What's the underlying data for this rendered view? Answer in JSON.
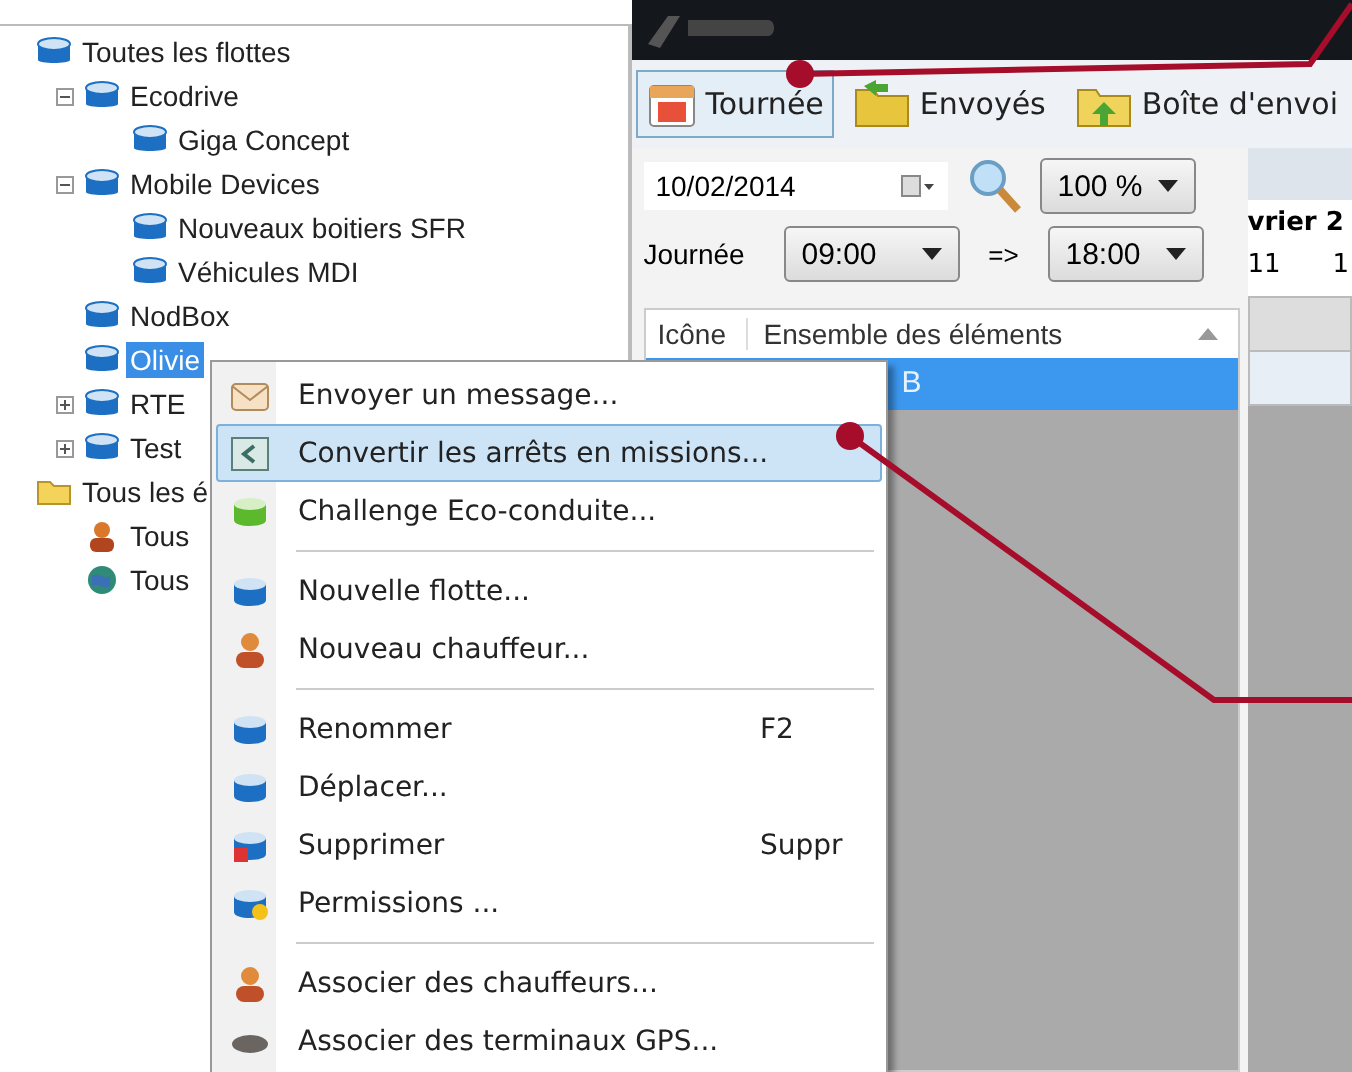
{
  "tree": [
    {
      "label": "Toutes les flottes",
      "kind": "fleet",
      "selected": false,
      "children": [
        {
          "label": "Ecodrive",
          "kind": "fleet",
          "expanded": true,
          "selected": false,
          "children": [
            {
              "label": "Giga Concept",
              "kind": "fleet",
              "selected": false
            }
          ]
        },
        {
          "label": "Mobile Devices",
          "kind": "fleet",
          "expanded": true,
          "selected": false,
          "children": [
            {
              "label": "Nouveaux boitiers SFR",
              "kind": "fleet",
              "selected": false
            },
            {
              "label": "Véhicules MDI",
              "kind": "fleet",
              "selected": false
            }
          ]
        },
        {
          "label": "NodBox",
          "kind": "fleet",
          "selected": false
        },
        {
          "label": "Olivie",
          "kind": "fleet",
          "selected": true
        },
        {
          "label": "RTE",
          "kind": "fleet",
          "expanded": false,
          "selected": false
        },
        {
          "label": "Test",
          "kind": "fleet",
          "expanded": false,
          "selected": false
        }
      ]
    },
    {
      "label": "Tous les é",
      "kind": "folder",
      "selected": false,
      "children": [
        {
          "label": "Tous",
          "kind": "driver",
          "selected": false
        },
        {
          "label": "Tous",
          "kind": "globe",
          "selected": false
        }
      ]
    }
  ],
  "toolbar": [
    {
      "label": "Tournée",
      "kind": "calendar",
      "selected": true
    },
    {
      "label": "Envoyés",
      "kind": "sent",
      "selected": false
    },
    {
      "label": "Boîte d'envoi",
      "kind": "outbox",
      "selected": false
    }
  ],
  "date_field": {
    "value": "10/02/2014"
  },
  "zoom_combo": {
    "value": "100 %"
  },
  "day_label": "Journée",
  "start_combo": {
    "value": "09:00"
  },
  "range_arrow": "=>",
  "end_combo": {
    "value": "18:00"
  },
  "grid": {
    "columns": [
      "Icône",
      "Ensemble des éléments"
    ],
    "rows": [
      {
        "text": "B",
        "selected": true
      }
    ]
  },
  "calendar": {
    "month": "vrier 2",
    "days": [
      "11",
      "1"
    ]
  },
  "context_menu": [
    {
      "kind": "mail",
      "label": "Envoyer un message...",
      "selected": false
    },
    {
      "kind": "convert",
      "label": "Convertir les arrêts en missions...",
      "selected": true
    },
    {
      "kind": "eco",
      "label": "Challenge Eco-conduite...",
      "selected": false
    },
    {
      "kind": "separator"
    },
    {
      "kind": "fleet",
      "label": "Nouvelle flotte...",
      "selected": false
    },
    {
      "kind": "person",
      "label": "Nouveau chauffeur...",
      "selected": false
    },
    {
      "kind": "separator"
    },
    {
      "kind": "fleet",
      "label": "Renommer",
      "shortcut": "F2",
      "selected": false
    },
    {
      "kind": "fleet",
      "label": "Déplacer...",
      "selected": false
    },
    {
      "kind": "delete",
      "label": "Supprimer",
      "shortcut": "Suppr",
      "selected": false
    },
    {
      "kind": "permission",
      "label": "Permissions ...",
      "selected": false
    },
    {
      "kind": "separator"
    },
    {
      "kind": "person",
      "label": "Associer des chauffeurs...",
      "selected": false
    },
    {
      "kind": "gps",
      "label": "Associer des terminaux GPS...",
      "selected": false
    }
  ]
}
